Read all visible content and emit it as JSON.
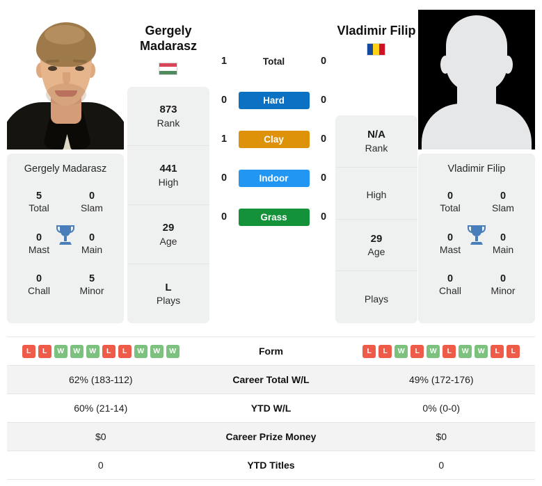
{
  "players": {
    "left": {
      "name": "Gergely Madarasz",
      "display_name_line1": "Gergely",
      "display_name_line2": "Madarasz",
      "flag": "hungary",
      "flag_colors": [
        "#d9465a",
        "#ffffff",
        "#4e8c5d"
      ],
      "flag_orientation": "horizontal",
      "photo": "player-photo",
      "titles": {
        "total_value": "5",
        "total_label": "Total",
        "slam_value": "0",
        "slam_label": "Slam",
        "mast_value": "0",
        "mast_label": "Mast",
        "main_value": "0",
        "main_label": "Main",
        "chall_value": "0",
        "chall_label": "Chall",
        "minor_value": "5",
        "minor_label": "Minor"
      },
      "rank_rows": [
        {
          "value": "873",
          "label": "Rank"
        },
        {
          "value": "441",
          "label": "High"
        },
        {
          "value": "29",
          "label": "Age"
        },
        {
          "value": "L",
          "label": "Plays"
        }
      ],
      "form": [
        "L",
        "L",
        "W",
        "W",
        "W",
        "L",
        "L",
        "W",
        "W",
        "W"
      ],
      "career_total_wl": "62% (183-112)",
      "ytd_wl": "60% (21-14)",
      "career_prize_money": "$0",
      "ytd_titles": "0"
    },
    "right": {
      "name": "Vladimir Filip",
      "display_name_line1": "Vladimir Filip",
      "display_name_line2": "",
      "flag": "romania",
      "flag_colors": [
        "#15499b",
        "#fcd116",
        "#ce1126"
      ],
      "flag_orientation": "vertical",
      "photo": "player-silhouette-placeholder",
      "titles": {
        "total_value": "0",
        "total_label": "Total",
        "slam_value": "0",
        "slam_label": "Slam",
        "mast_value": "0",
        "mast_label": "Mast",
        "main_value": "0",
        "main_label": "Main",
        "chall_value": "0",
        "chall_label": "Chall",
        "minor_value": "0",
        "minor_label": "Minor"
      },
      "rank_rows": [
        {
          "value": "N/A",
          "label": "Rank"
        },
        {
          "value": "",
          "label": "High"
        },
        {
          "value": "29",
          "label": "Age"
        },
        {
          "value": "",
          "label": "Plays"
        }
      ],
      "form": [
        "L",
        "L",
        "W",
        "L",
        "W",
        "L",
        "W",
        "W",
        "L",
        "L"
      ],
      "career_total_wl": "49% (172-176)",
      "ytd_wl": "0% (0-0)",
      "career_prize_money": "$0",
      "ytd_titles": "0"
    }
  },
  "head_to_head": {
    "rows": [
      {
        "label": "Total",
        "left": "1",
        "right": "0",
        "color": "none",
        "style": "plain"
      },
      {
        "label": "Hard",
        "left": "0",
        "right": "0",
        "color": "#0c71c3",
        "style": "badge"
      },
      {
        "label": "Clay",
        "left": "1",
        "right": "0",
        "color": "#dd9209",
        "style": "badge"
      },
      {
        "label": "Indoor",
        "left": "0",
        "right": "0",
        "color": "#2196f3",
        "style": "badge"
      },
      {
        "label": "Grass",
        "left": "0",
        "right": "0",
        "color": "#13923a",
        "style": "badge"
      }
    ]
  },
  "table": {
    "rows": [
      {
        "label": "Form",
        "type": "form"
      },
      {
        "label": "Career Total W/L",
        "type": "text",
        "key": "career_total_wl"
      },
      {
        "label": "YTD W/L",
        "type": "text",
        "key": "ytd_wl"
      },
      {
        "label": "Career Prize Money",
        "type": "text",
        "key": "career_prize_money"
      },
      {
        "label": "YTD Titles",
        "type": "text",
        "key": "ytd_titles"
      }
    ]
  },
  "colors": {
    "win_badge": "#7cc27e",
    "loss_badge": "#ee5b48",
    "card_bg": "#eff0f0",
    "trophy": "#4a7ebb",
    "row_alt": "#f3f3f3"
  },
  "icons": {
    "trophy": "trophy-icon"
  }
}
